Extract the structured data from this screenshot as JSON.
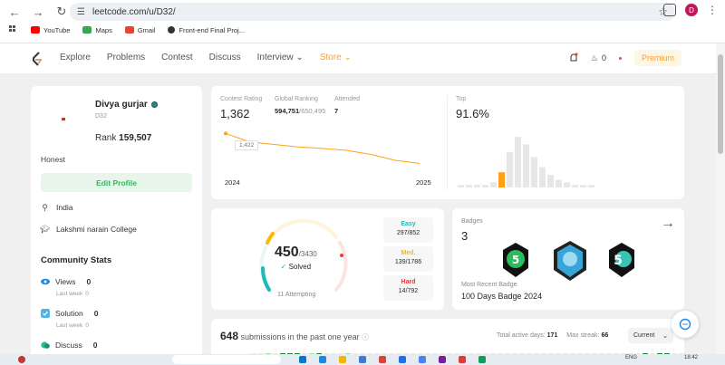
{
  "browser": {
    "url": "leetcode.com/u/D32/",
    "profile_initial": "D",
    "bookmarks": [
      {
        "label": "YouTube",
        "color": "#ff0000"
      },
      {
        "label": "Maps",
        "color": "#34a853"
      },
      {
        "label": "Gmail",
        "color": "#ea4335"
      },
      {
        "label": "Front-end Final Proj...",
        "color": "#333333"
      }
    ]
  },
  "nav": {
    "links": [
      "Explore",
      "Problems",
      "Contest",
      "Discuss",
      "Interview",
      "Store"
    ],
    "streak_count": "0",
    "premium_label": "Premium"
  },
  "profile": {
    "name": "Divya gurjar",
    "username": "D32",
    "rank_label": "Rank",
    "rank_value": "159,507",
    "bio": "Honest",
    "edit_label": "Edit Profile",
    "location": "India",
    "school": "Lakshmi narain College"
  },
  "community": {
    "title": "Community Stats",
    "stats": [
      {
        "label": "Views",
        "value": "0",
        "sub_label": "Last week",
        "sub_value": "0"
      },
      {
        "label": "Solution",
        "value": "0",
        "sub_label": "Last week",
        "sub_value": "0"
      },
      {
        "label": "Discuss",
        "value": "0"
      }
    ]
  },
  "contest": {
    "rating_label": "Contest Rating",
    "rating": "1,362",
    "global_label": "Global Ranking",
    "global_rank": "594,751",
    "global_total": "/650,495",
    "attended_label": "Attended",
    "attended": "7",
    "tooltip": "1,422",
    "year_start": "2024",
    "year_end": "2025",
    "top_label": "Top",
    "top_value": "91.6%"
  },
  "solved": {
    "count": "450",
    "total": "/3430",
    "solved_label": "Solved",
    "attempting": "11 Attempting",
    "difficulties": [
      {
        "label": "Easy",
        "value": "297/852",
        "color": "#1cbaba"
      },
      {
        "label": "Med.",
        "value": "139/1786",
        "color": "#ffb700"
      },
      {
        "label": "Hard",
        "value": "14/792",
        "color": "#f63737"
      }
    ]
  },
  "badges": {
    "label": "Badges",
    "count": "3",
    "recent_label": "Most Recent Badge",
    "recent": "100 Days Badge 2024"
  },
  "submissions": {
    "count": "648",
    "label": "submissions in the past one year",
    "active_label": "Total active days:",
    "active_days": "171",
    "streak_label": "Max streak:",
    "max_streak": "66",
    "select_value": "Current"
  },
  "taskbar": {
    "lang": "ENG",
    "time": "18:42"
  },
  "chart_data": {
    "type": "line",
    "x": [
      "2024",
      "",
      "",
      "",
      "",
      "",
      "",
      "",
      "2025"
    ],
    "series": [
      {
        "values": [
          1422,
          1405,
          1400,
          1395,
          1392,
          1388,
          1380,
          1368,
          1362
        ]
      }
    ],
    "histogram": {
      "type": "bar",
      "values": [
        1,
        1,
        1,
        1,
        2,
        6,
        14,
        20,
        17,
        12,
        8,
        5,
        3,
        2,
        1,
        1,
        1
      ],
      "highlight_index": 5
    }
  }
}
